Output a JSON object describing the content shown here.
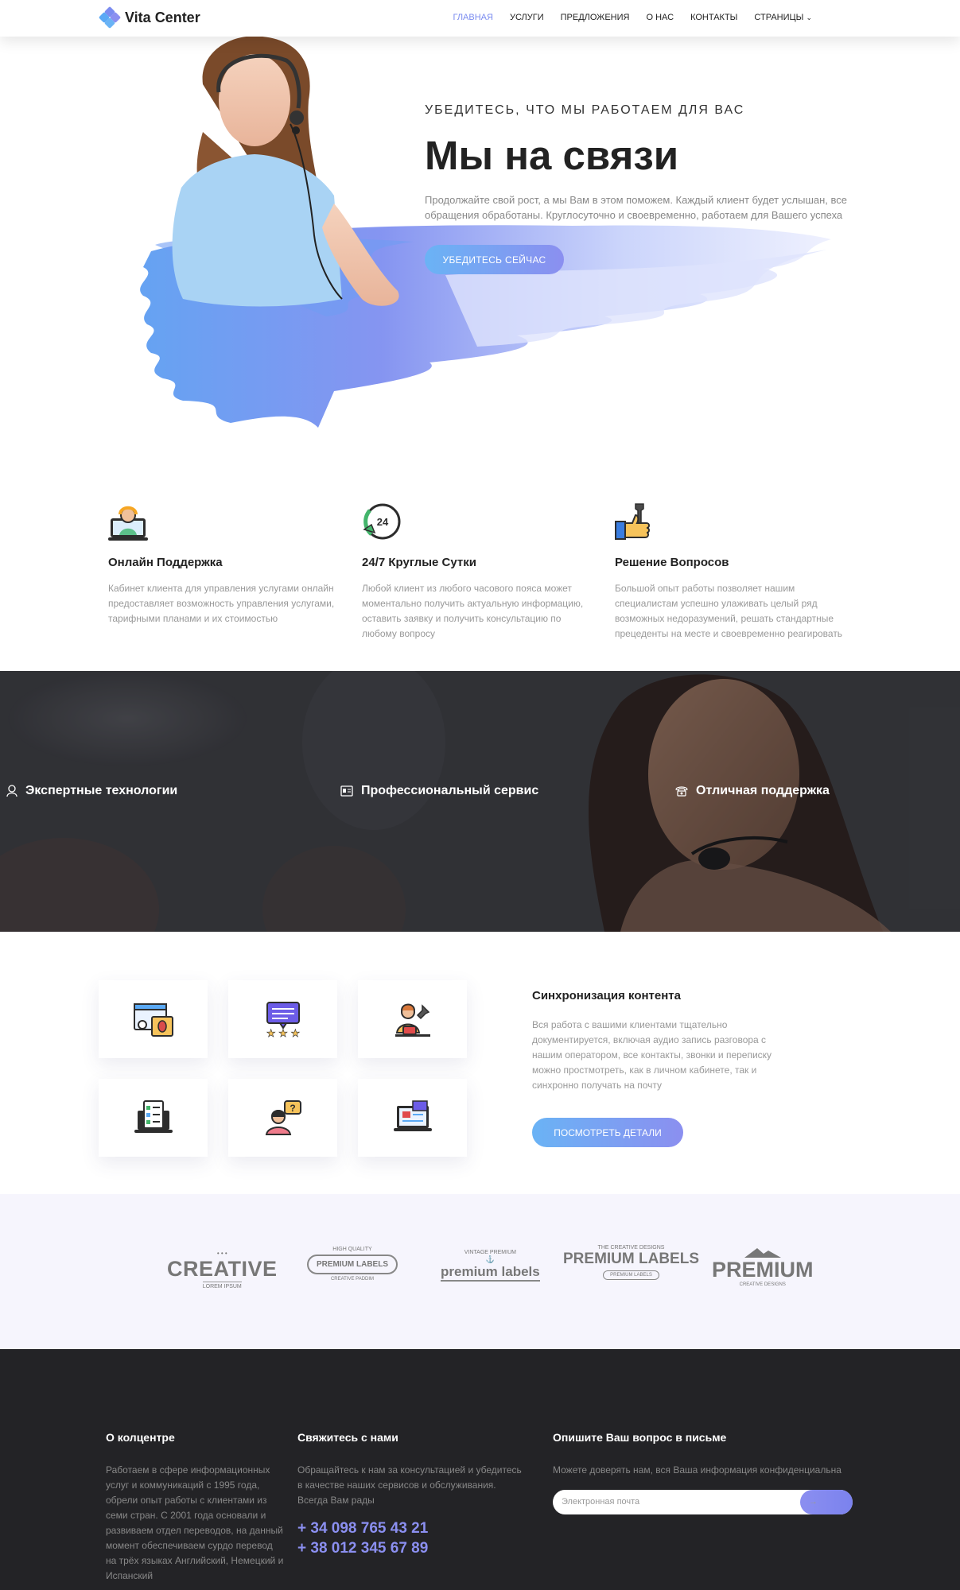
{
  "brand": {
    "name": "Vita Center",
    "colors": {
      "accent": "#7b8cf0",
      "gradient_start": "#6ab3f5",
      "gradient_end": "#8b8ff0"
    }
  },
  "nav": {
    "items": [
      {
        "label": "ГЛАВНАЯ",
        "active": true
      },
      {
        "label": "УСЛУГИ"
      },
      {
        "label": "ПРЕДЛОЖЕНИЯ"
      },
      {
        "label": "О НАС"
      },
      {
        "label": "КОНТАКТЫ"
      },
      {
        "label": "СТРАНИЦЫ",
        "dropdown_icon": "chevron-down-icon"
      }
    ]
  },
  "hero": {
    "eyebrow": "УБЕДИТЕСЬ, ЧТО МЫ РАБОТАЕМ ДЛЯ ВАС",
    "title": "Мы на связи",
    "text": "Продолжайте свой рост, а мы Вам в этом поможем. Каждый клиент будет услышан, все обращения обработаны. Круглосуточно и своевременно, работаем для Вашего успеха",
    "button": "УБЕДИТЕСЬ СЕЙЧАС"
  },
  "features": [
    {
      "icon": "support-agent-icon",
      "title": "Онлайн Поддержка",
      "text": "Кабинет клиента для управления услугами онлайн предоставляет возможность управления услугами, тарифными планами и их стоимостью"
    },
    {
      "icon": "clock-24-icon",
      "title": "24/7 Круглые Сутки",
      "text": "Любой клиент из любого часового пояса может моментально получить актуальную информацию, оставить заявку и получить консультацию по любому вопросу"
    },
    {
      "icon": "thumbs-up-wrench-icon",
      "title": "Решение Вопросов",
      "text": "Большой опыт работы позволяет нашим специалистам успешно улаживать целый ряд возможных недоразумений, решать стандартные прецеденты на месте и своевременно реагировать"
    }
  ],
  "clock_label": "24",
  "band": {
    "items": [
      {
        "icon": "user-icon",
        "label": "Экспертные технологии"
      },
      {
        "icon": "id-card-icon",
        "label": "Профессиональный сервис"
      },
      {
        "icon": "phone-icon",
        "label": "Отличная поддержка"
      }
    ]
  },
  "services": {
    "tiles": [
      {
        "icon": "bug-report-icon"
      },
      {
        "icon": "rating-stars-icon"
      },
      {
        "icon": "technician-icon"
      },
      {
        "icon": "checklist-laptop-icon"
      },
      {
        "icon": "question-agent-icon"
      },
      {
        "icon": "document-laptop-icon"
      }
    ],
    "title": "Синхронизация контента",
    "text": "Вся работа с вашими клиентами тщательно документируется, включая аудио запись разговора с нашим оператором, все контакты, звонки и переписку можно простмотреть, как в личном кабинете, так и синхронно получать на почту",
    "button": "ПОСМОТРЕТЬ ДЕТАЛИ"
  },
  "logos": [
    {
      "main": "CREATIVE",
      "sub": "LOREM IPSUM"
    },
    {
      "top": "HIGH QUALITY",
      "main": "PREMIUM LABELS",
      "sub": "CREATIVE PADDIM"
    },
    {
      "top": "VINTAGE PREMIUM",
      "main": "premium labels"
    },
    {
      "top": "THE CREATIVE DESIGNS",
      "main": "PREMIUM LABELS",
      "sub": "PREMIUM LABELS"
    },
    {
      "main": "PREMIUM",
      "sub": "CREATIVE DESIGNS"
    }
  ],
  "footer": {
    "about": {
      "title": "О колцентре",
      "text": "Работаем в сфере информационных услуг и коммуникаций с 1995 года, обрели опыт работы с клиентами из семи стран. С 2001 года основали и развиваем отдел переводов, на данный момент обеспечиваем сурдо перевод на трёх языках Английский, Немецкий и Испанский"
    },
    "contact": {
      "title": "Свяжитесь с нами",
      "text": "Обращайтесь к нам за консультацией и убедитесь в качестве наших сервисов и обслуживания. Всегда Вам рады",
      "phones": [
        "+ 34 098 765 43 21",
        "+ 38 012 345 67 89"
      ]
    },
    "mail": {
      "title": "Опишите Ваш вопрос в письме",
      "text": "Можете доверять нам, вся Ваша информация конфиденциальна",
      "placeholder": "Электронная почта",
      "submit_icon": "arrow-right-icon"
    }
  }
}
